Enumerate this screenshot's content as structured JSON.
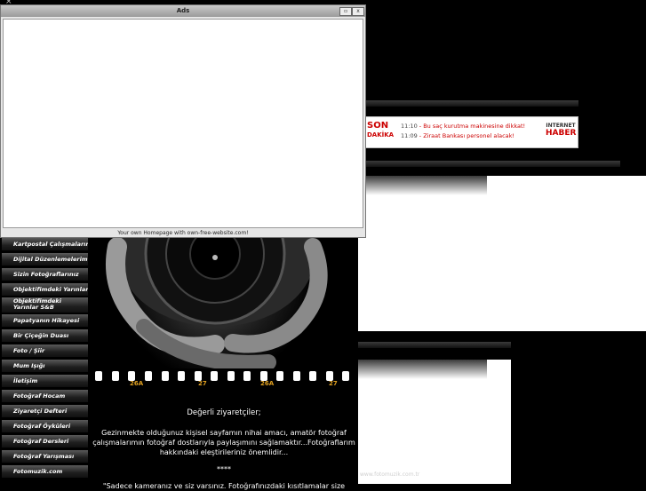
{
  "corner": {
    "mark": "×"
  },
  "ads": {
    "title": "Ads",
    "footer": "Your own Homepage with own-free-website.com!",
    "restore_glyph": "▫",
    "close_glyph": "x"
  },
  "news": {
    "logo_left_1": "SON",
    "logo_left_2": "DAKİKA",
    "items": [
      {
        "time": "11:10",
        "text": "Bu saç kurutma makinesine dikkat!"
      },
      {
        "time": "11:09",
        "text": "Ziraat Bankası personel alacak!"
      }
    ],
    "logo_right_1": "INTERNET",
    "logo_right_2": "HABER"
  },
  "sidebar": {
    "items": [
      {
        "label": "Kartpostal Çalışmalarım"
      },
      {
        "label": "Dijital Düzenlemelerim"
      },
      {
        "label": "Sizin Fotoğraflarınız"
      },
      {
        "label": "Objektifimdeki Yarınlar"
      },
      {
        "label": "Objektifimdeki Yarınlar S&B"
      },
      {
        "label": "Papatyanın Hikayesi"
      },
      {
        "label": "Bir Çiçeğin Duası"
      },
      {
        "label": "Foto / Şiir"
      },
      {
        "label": "Mum Işığı"
      },
      {
        "label": "İletişim"
      },
      {
        "label": "Fotoğraf Hocam"
      },
      {
        "label": "Ziyaretçi Defteri"
      },
      {
        "label": "Fotoğraf Öyküleri"
      },
      {
        "label": "Fotoğraf Dersleri"
      },
      {
        "label": "Fotoğraf Yarışması"
      },
      {
        "label": "Fotomuzik.com"
      }
    ]
  },
  "film": {
    "labels": [
      "26A",
      "27",
      "26A",
      "27"
    ]
  },
  "main": {
    "greeting": "Değerli ziyaretçiler;",
    "paragraph": "Gezinmekte olduğunuz kişisel sayfamın nihai amacı, amatör  fotoğraf çalışmalarımın fotoğraf dostlarıyla paylaşımını sağlamaktır...Fotoğraflarım hakkındaki eleştirileriniz önemlidir...",
    "separator": "****",
    "quote": "\"Sadece kameranız ve siz varsınız. Fotoğrafınızdaki kısıtlamalar size"
  },
  "panel2": {
    "caption": "www.fotomuzik.com.tr"
  }
}
